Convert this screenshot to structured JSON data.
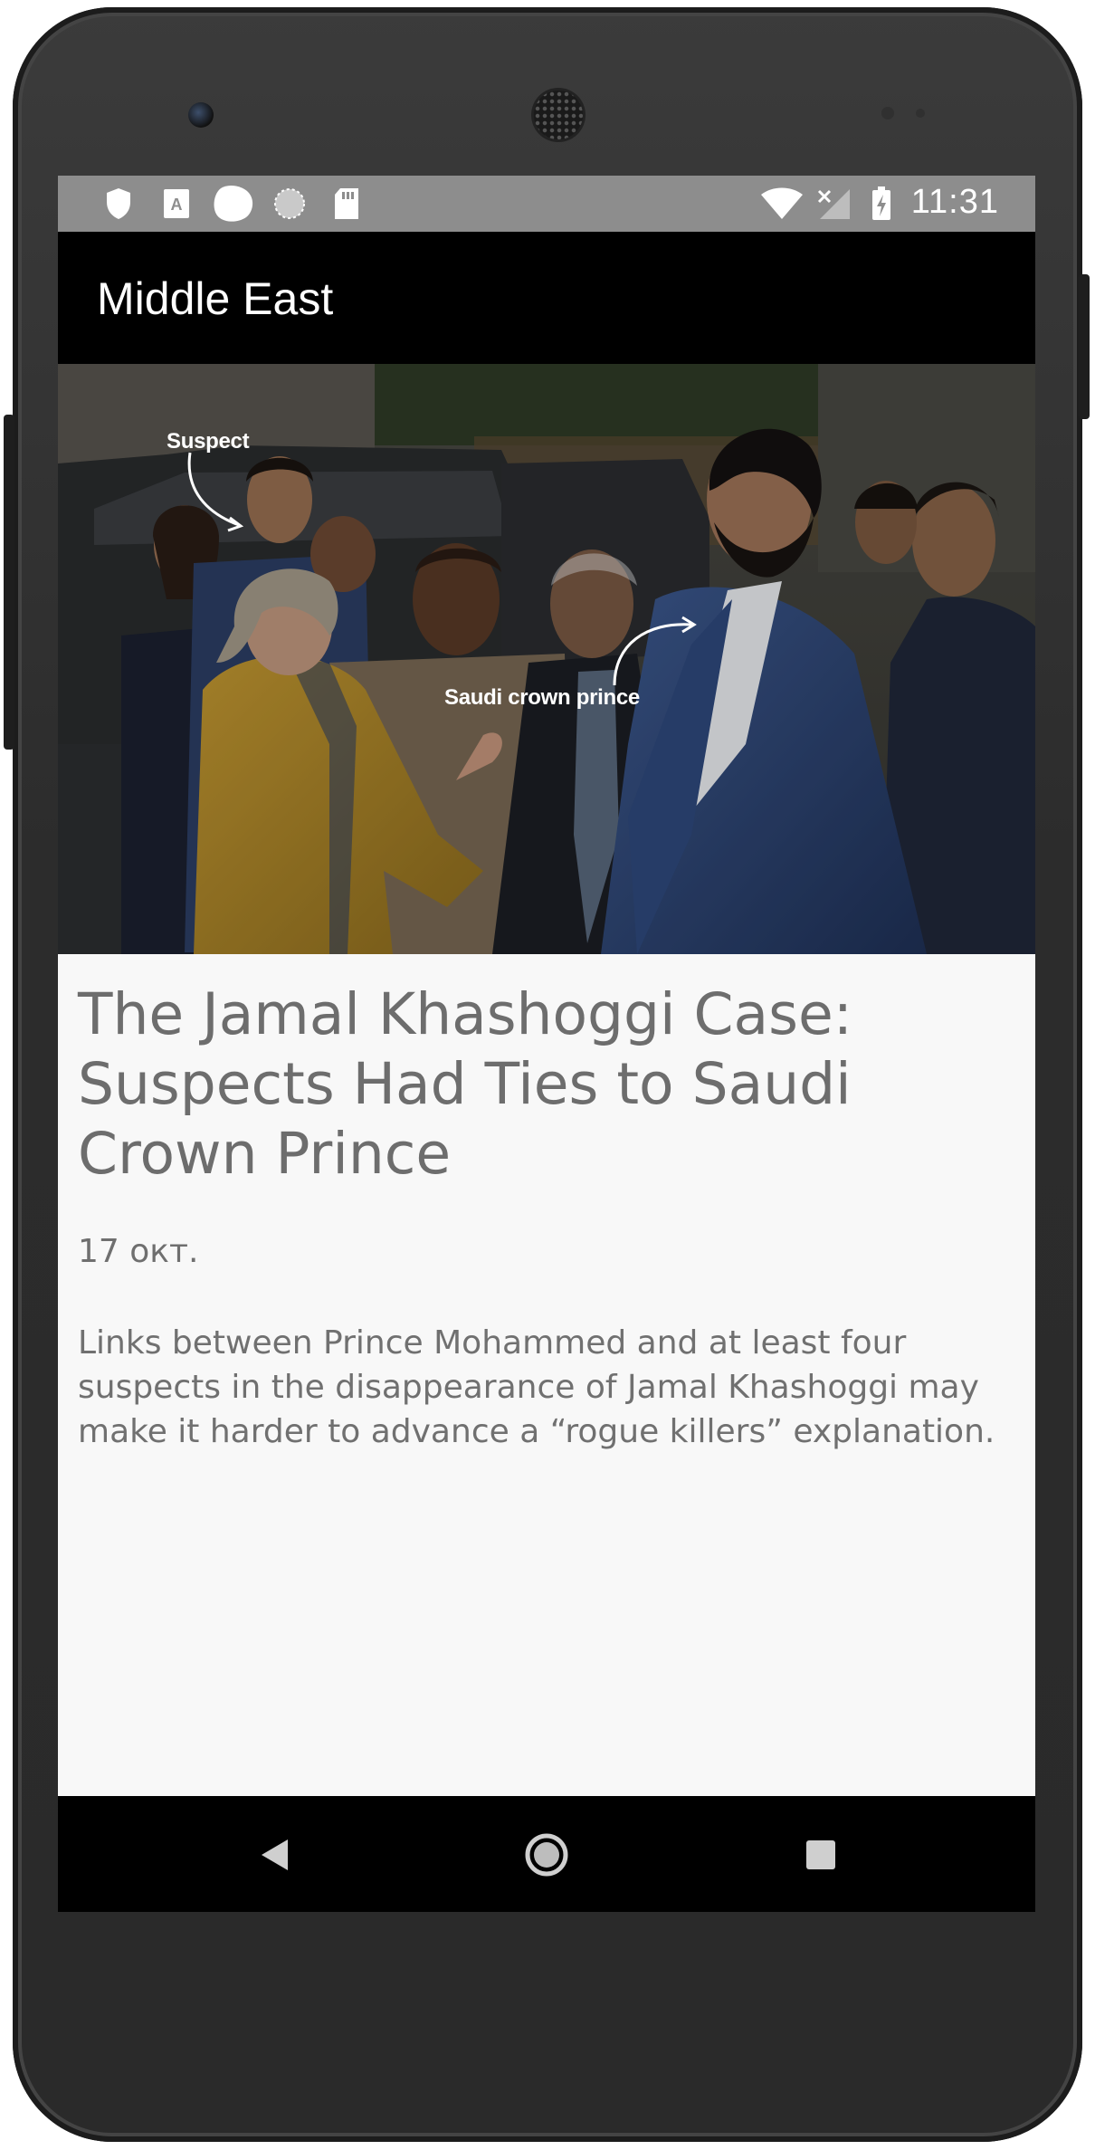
{
  "status_bar": {
    "time": "11:31",
    "left_icons": [
      "shield-icon",
      "text-a-icon",
      "blob-app-icon",
      "dotted-circle-icon",
      "sd-card-icon"
    ],
    "right_icons": [
      "wifi-icon",
      "cell-signal-off-icon",
      "battery-charging-icon"
    ]
  },
  "app_bar": {
    "title": "Middle East"
  },
  "hero_image": {
    "annotation_suspect": "Suspect",
    "annotation_prince": "Saudi crown prince"
  },
  "article": {
    "headline": "The Jamal Khashoggi Case: Suspects Had Ties to Saudi Crown Prince",
    "date": "17 окт.",
    "summary": "Links between Prince Mohammed and at least four suspects in the disappearance of Jamal Khashoggi may make it harder to advance a “rogue killers” explanation."
  },
  "nav_bar": {
    "buttons": [
      "back-icon",
      "home-icon",
      "recents-icon"
    ]
  }
}
